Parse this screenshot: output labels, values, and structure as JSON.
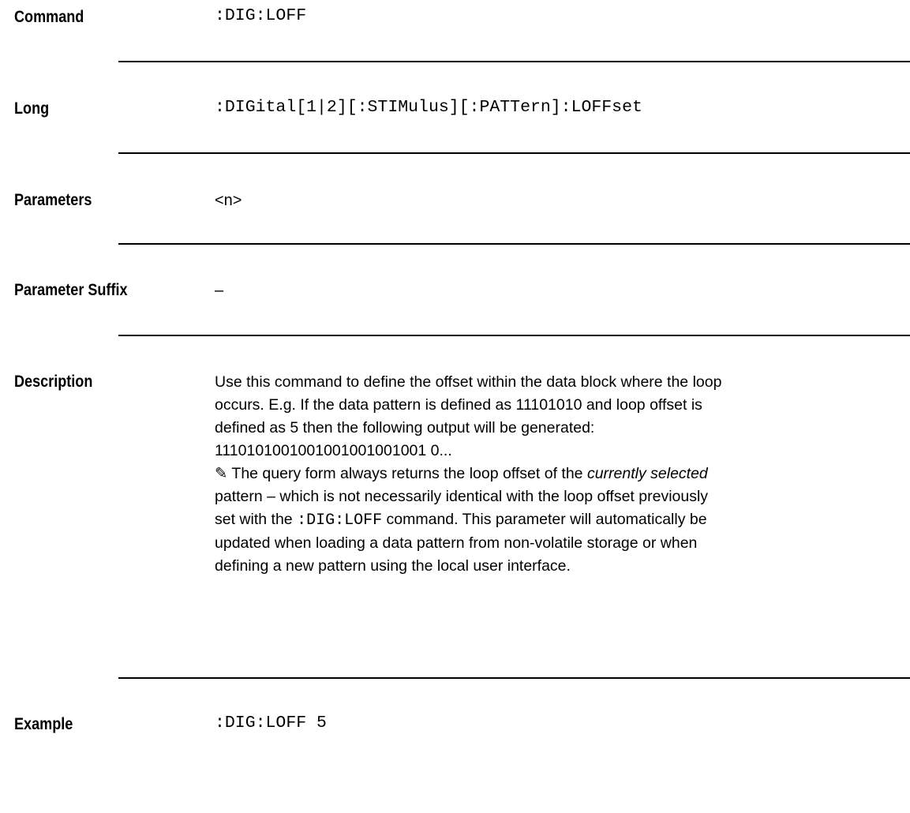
{
  "rows": {
    "command": {
      "label": "Command",
      "value": ":DIG:LOFF"
    },
    "long": {
      "label": "Long",
      "value": ":DIGital[1|2][:STIMulus][:PATTern]:LOFFset"
    },
    "parameters": {
      "label": "Parameters",
      "value": "<n>"
    },
    "parameter_suffix": {
      "label": "Parameter Suffix",
      "value": "–"
    },
    "description": {
      "label": "Description",
      "paragraph1_lines": [
        "Use this command to define the offset within the data block where the loop",
        "occurs. E.g. If the data pattern is defined as 11101010 and loop offset is",
        "defined as 5 then the following output will be generated:",
        "1110101001001001001001001 0..."
      ],
      "note": {
        "icon": "pencil-icon",
        "line1_pre": " The query form always returns the loop offset of the ",
        "line1_em": "currently selected",
        "line2": "pattern – which is not necessarily identical with the loop offset previously",
        "line3_pre": "set with the ",
        "line3_code": ":DIG:LOFF",
        "line3_post": " command. This parameter will automatically be",
        "line4": "updated when loading a data pattern from non-volatile storage or when",
        "line5": "defining a new pattern using the local user interface."
      }
    },
    "example": {
      "label": "Example",
      "value": ":DIG:LOFF 5"
    }
  }
}
